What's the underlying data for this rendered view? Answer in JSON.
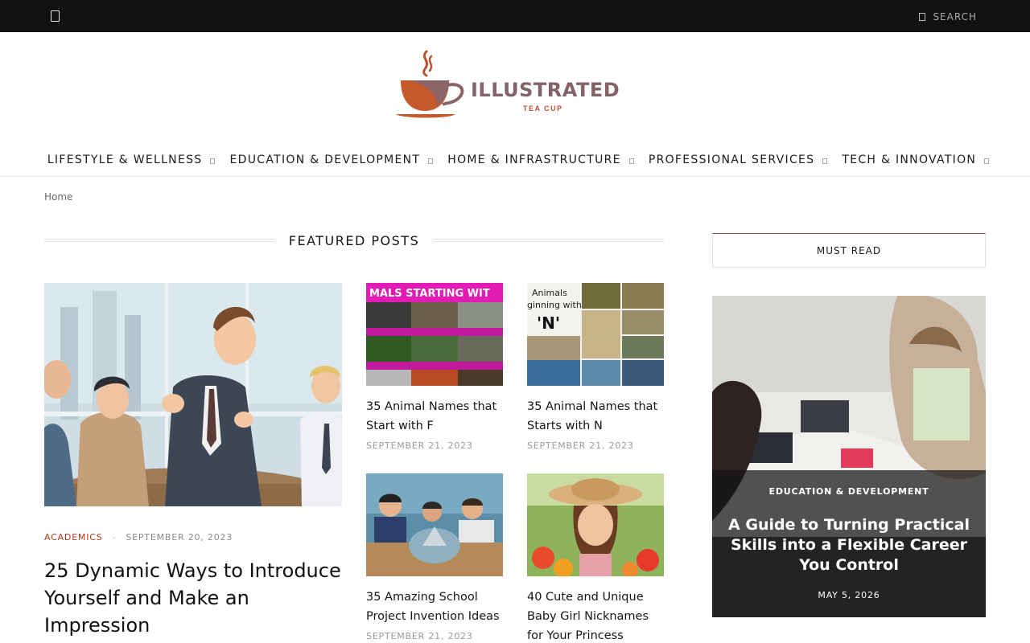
{
  "topbar": {
    "search_label": "SEARCH"
  },
  "brand": {
    "name": "ILLUSTRATED",
    "tagline": "TEA CUP",
    "accent": "#b85231",
    "text_color": "#836369"
  },
  "nav": [
    {
      "label": "LIFESTYLE & WELLNESS"
    },
    {
      "label": "EDUCATION & DEVELOPMENT"
    },
    {
      "label": "HOME & INFRASTRUCTURE"
    },
    {
      "label": "PROFESSIONAL SERVICES"
    },
    {
      "label": "TECH & INNOVATION"
    }
  ],
  "breadcrumb": {
    "home": "Home"
  },
  "featured": {
    "heading": "FEATURED POSTS",
    "main": {
      "category": "ACADEMICS",
      "separator": "-",
      "date": "SEPTEMBER 20, 2023",
      "title": "25 Dynamic Ways to Introduce Yourself and Make an Impression"
    },
    "cards": [
      {
        "title": "35 Animal Names that Start with F",
        "date": "SEPTEMBER 21, 2023",
        "image_text": "MALS STARTING WIT"
      },
      {
        "title": "35 Animal Names that Starts with N",
        "date": "SEPTEMBER 21, 2023",
        "image_text_1": "Animals",
        "image_text_2": "ginning with",
        "image_text_3": "'N'"
      },
      {
        "title": "35 Amazing School Project Invention Ideas",
        "date": "SEPTEMBER 21, 2023"
      },
      {
        "title": "40 Cute and Unique Baby Girl Nicknames for Your Princess",
        "date": ""
      }
    ]
  },
  "sidebar": {
    "heading": "MUST READ",
    "post": {
      "category": "EDUCATION & DEVELOPMENT",
      "title": "A Guide to Turning Practical Skills into a Flexible Career You Control",
      "date": "MAY 5, 2026"
    }
  }
}
